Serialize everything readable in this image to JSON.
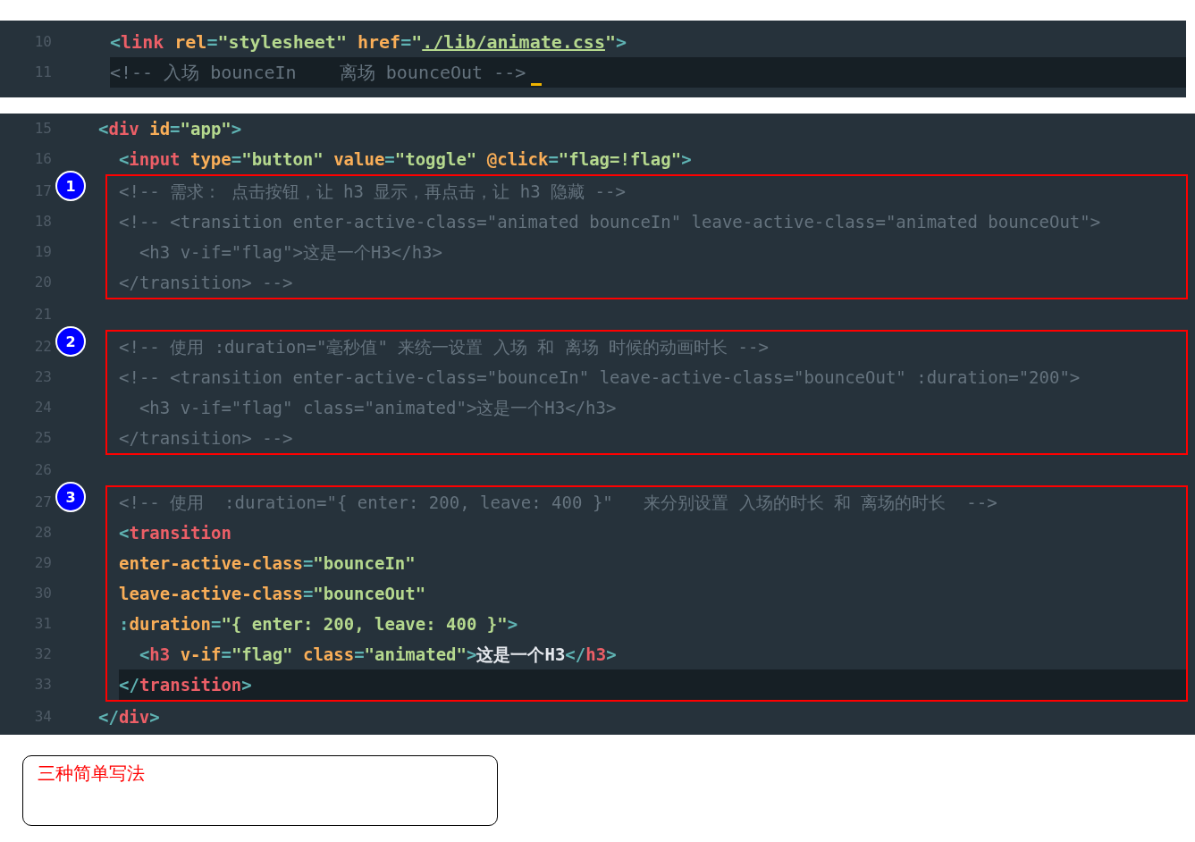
{
  "panels": [
    {
      "groups": [
        {
          "lines": [
            {
              "number": "10",
              "highlighted": false,
              "cursor": false,
              "tokens": [
                {
                  "kind": "punct",
                  "text": "<"
                },
                {
                  "kind": "tag",
                  "text": "link"
                },
                {
                  "kind": "attr",
                  "text": " rel"
                },
                {
                  "kind": "punct",
                  "text": "="
                },
                {
                  "kind": "str",
                  "text": "\"stylesheet\""
                },
                {
                  "kind": "attr",
                  "text": " href"
                },
                {
                  "kind": "punct",
                  "text": "="
                },
                {
                  "kind": "str",
                  "text": "\""
                },
                {
                  "kind": "link",
                  "text": "./lib/animate.css"
                },
                {
                  "kind": "str",
                  "text": "\""
                },
                {
                  "kind": "punct",
                  "text": ">"
                }
              ]
            },
            {
              "number": "11",
              "highlighted": true,
              "cursor": true,
              "tokens": [
                {
                  "kind": "comment",
                  "text": "<!-- 入场 bounceIn    离场 bounceOut -->"
                }
              ]
            }
          ]
        }
      ]
    },
    {
      "groups": [
        {
          "lines": [
            {
              "number": "15",
              "highlighted": false,
              "tokens": [
                {
                  "kind": "punct",
                  "text": "<"
                },
                {
                  "kind": "tag",
                  "text": "div"
                },
                {
                  "kind": "attr",
                  "text": " id"
                },
                {
                  "kind": "punct",
                  "text": "="
                },
                {
                  "kind": "str",
                  "text": "\"app\""
                },
                {
                  "kind": "punct",
                  "text": ">"
                }
              ]
            },
            {
              "number": "16",
              "highlighted": false,
              "tokens": [
                {
                  "kind": "punct",
                  "text": "  <"
                },
                {
                  "kind": "tag",
                  "text": "input"
                },
                {
                  "kind": "attr",
                  "text": " type"
                },
                {
                  "kind": "punct",
                  "text": "="
                },
                {
                  "kind": "str",
                  "text": "\"button\""
                },
                {
                  "kind": "attr",
                  "text": " value"
                },
                {
                  "kind": "punct",
                  "text": "="
                },
                {
                  "kind": "str",
                  "text": "\"toggle\""
                },
                {
                  "kind": "attr",
                  "text": " @click"
                },
                {
                  "kind": "punct",
                  "text": "="
                },
                {
                  "kind": "str",
                  "text": "\"flag=!flag\""
                },
                {
                  "kind": "punct",
                  "text": ">"
                }
              ]
            }
          ]
        },
        {
          "badge": "1",
          "lines": [
            {
              "number": "17",
              "highlighted": false,
              "tokens": [
                {
                  "kind": "comment",
                  "text": "<!-- 需求： 点击按钮，让 h3 显示，再点击，让 h3 隐藏 -->"
                }
              ]
            },
            {
              "number": "18",
              "highlighted": false,
              "tokens": [
                {
                  "kind": "comment",
                  "text": "<!-- <transition enter-active-class=\"animated bounceIn\" leave-active-class=\"animated bounceOut\">"
                }
              ]
            },
            {
              "number": "19",
              "highlighted": false,
              "tokens": [
                {
                  "kind": "comment",
                  "text": "  <h3 v-if=\"flag\">这是一个H3</h3>"
                }
              ]
            },
            {
              "number": "20",
              "highlighted": false,
              "tokens": [
                {
                  "kind": "comment",
                  "text": "</transition> -->"
                }
              ]
            }
          ]
        },
        {
          "lines": [
            {
              "number": "21",
              "highlighted": false
            }
          ]
        },
        {
          "badge": "2",
          "lines": [
            {
              "number": "22",
              "highlighted": false,
              "tokens": [
                {
                  "kind": "comment",
                  "text": "<!-- 使用 :duration=\"毫秒值\" 来统一设置 入场 和 离场 时候的动画时长 -->"
                }
              ]
            },
            {
              "number": "23",
              "highlighted": false,
              "tokens": [
                {
                  "kind": "comment",
                  "text": "<!-- <transition enter-active-class=\"bounceIn\" leave-active-class=\"bounceOut\" :duration=\"200\">"
                }
              ]
            },
            {
              "number": "24",
              "highlighted": false,
              "tokens": [
                {
                  "kind": "comment",
                  "text": "  <h3 v-if=\"flag\" class=\"animated\">这是一个H3</h3>"
                }
              ]
            },
            {
              "number": "25",
              "highlighted": false,
              "tokens": [
                {
                  "kind": "comment",
                  "text": "</transition> -->"
                }
              ]
            }
          ]
        },
        {
          "lines": [
            {
              "number": "26",
              "highlighted": false
            }
          ]
        },
        {
          "badge": "3",
          "lines": [
            {
              "number": "27",
              "highlighted": false,
              "tokens": [
                {
                  "kind": "comment",
                  "text": "<!-- 使用  :duration=\"{ enter: 200, leave: 400 }\"   来分别设置 入场的时长 和 离场的时长  -->"
                }
              ]
            },
            {
              "number": "28",
              "highlighted": false,
              "tokens": [
                {
                  "kind": "punct",
                  "text": "<"
                },
                {
                  "kind": "tag",
                  "text": "transition"
                }
              ]
            },
            {
              "number": "29",
              "highlighted": false,
              "tokens": [
                {
                  "kind": "attr",
                  "text": "enter-active-class"
                },
                {
                  "kind": "punct",
                  "text": "="
                },
                {
                  "kind": "str",
                  "text": "\"bounceIn\""
                }
              ]
            },
            {
              "number": "30",
              "highlighted": false,
              "tokens": [
                {
                  "kind": "attr",
                  "text": "leave-active-class"
                },
                {
                  "kind": "punct",
                  "text": "="
                },
                {
                  "kind": "str",
                  "text": "\"bounceOut\""
                }
              ]
            },
            {
              "number": "31",
              "highlighted": false,
              "tokens": [
                {
                  "kind": "punct",
                  "text": ":"
                },
                {
                  "kind": "attr",
                  "text": "duration"
                },
                {
                  "kind": "punct",
                  "text": "="
                },
                {
                  "kind": "str",
                  "text": "\"{ enter: 200, leave: 400 }\""
                },
                {
                  "kind": "punct",
                  "text": ">"
                }
              ]
            },
            {
              "number": "32",
              "highlighted": false,
              "tokens": [
                {
                  "kind": "punct",
                  "text": "  <"
                },
                {
                  "kind": "tag",
                  "text": "h3"
                },
                {
                  "kind": "attr",
                  "text": " v-if"
                },
                {
                  "kind": "punct",
                  "text": "="
                },
                {
                  "kind": "str",
                  "text": "\"flag\""
                },
                {
                  "kind": "attr",
                  "text": " class"
                },
                {
                  "kind": "punct",
                  "text": "="
                },
                {
                  "kind": "str",
                  "text": "\"animated\""
                },
                {
                  "kind": "punct",
                  "text": ">"
                },
                {
                  "kind": "text",
                  "text": "这是一个H3"
                },
                {
                  "kind": "punct",
                  "text": "</"
                },
                {
                  "kind": "tag",
                  "text": "h3"
                },
                {
                  "kind": "punct",
                  "text": ">"
                }
              ]
            },
            {
              "number": "33",
              "highlighted": true,
              "tokens": [
                {
                  "kind": "punct",
                  "text": "</"
                },
                {
                  "kind": "tag",
                  "text": "transition"
                },
                {
                  "kind": "punct",
                  "text": ">"
                }
              ]
            }
          ]
        },
        {
          "lines": [
            {
              "number": "34",
              "highlighted": false,
              "tokens": [
                {
                  "kind": "punct",
                  "text": "</"
                },
                {
                  "kind": "tag",
                  "text": "div"
                },
                {
                  "kind": "punct",
                  "text": ">"
                }
              ]
            }
          ]
        }
      ]
    }
  ],
  "note": {
    "text": "三种简单写法"
  }
}
